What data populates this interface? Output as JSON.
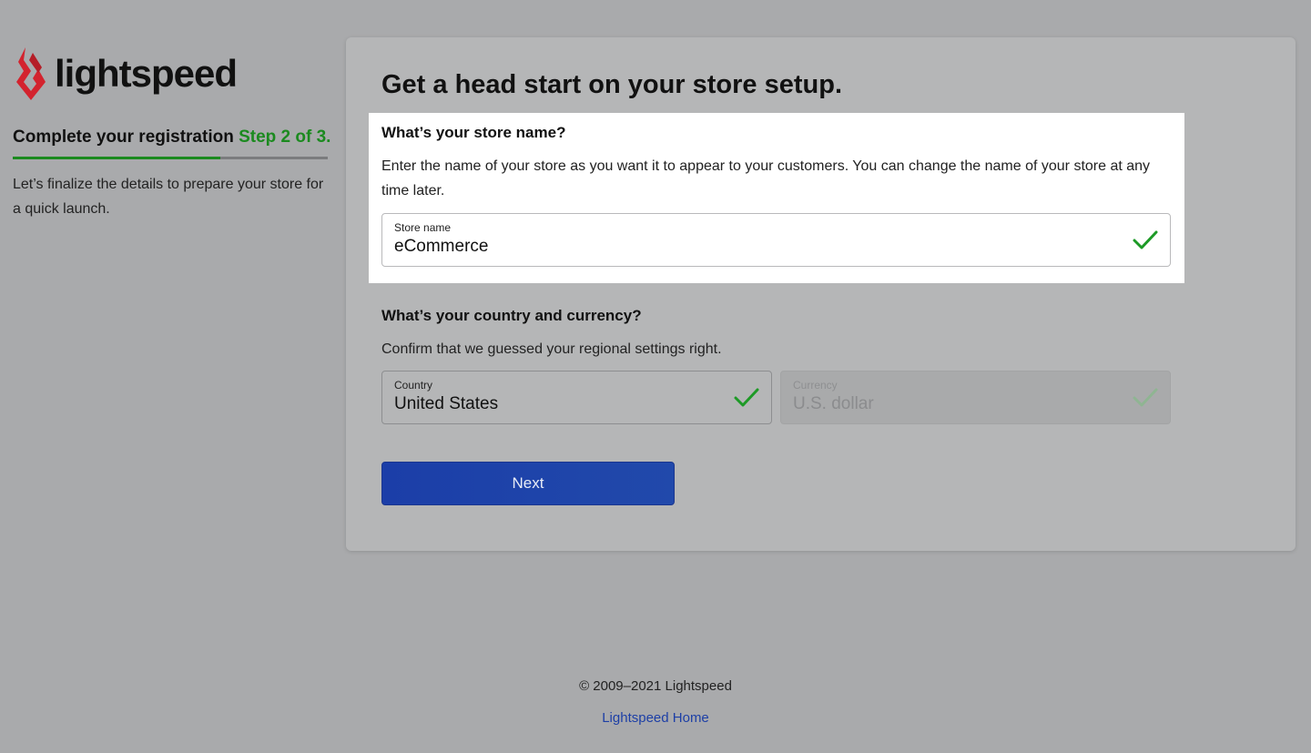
{
  "brand": {
    "name": "lightspeed",
    "logo_icon": "flame-logo-icon",
    "logo_color": "#d3232e"
  },
  "registration": {
    "title": "Complete your registration",
    "step": "Step 2 of 3.",
    "progress_fraction": 0.66,
    "description": "Let’s finalize the details to prepare your store for a quick launch."
  },
  "form": {
    "heading": "Get a head start on your store setup.",
    "store_section": {
      "question": "What’s your store name?",
      "description": "Enter the name of your store as you want it to appear to your customers. You can change the name of your store at any time later.",
      "field_label": "Store name",
      "field_value": "eCommerce",
      "valid": true
    },
    "region_section": {
      "question": "What’s your country and currency?",
      "description": "Confirm that we guessed your regional settings right.",
      "country_label": "Country",
      "country_value": "United States",
      "currency_label": "Currency",
      "currency_value": "U.S. dollar"
    },
    "next_label": "Next"
  },
  "footer": {
    "copyright": "© 2009–2021 Lightspeed",
    "home_link": "Lightspeed Home"
  },
  "colors": {
    "accent_green": "#1b8a1f",
    "check_green": "#1d9a26",
    "button_blue": "#1b3ea8",
    "link_blue": "#1d3fa6"
  }
}
